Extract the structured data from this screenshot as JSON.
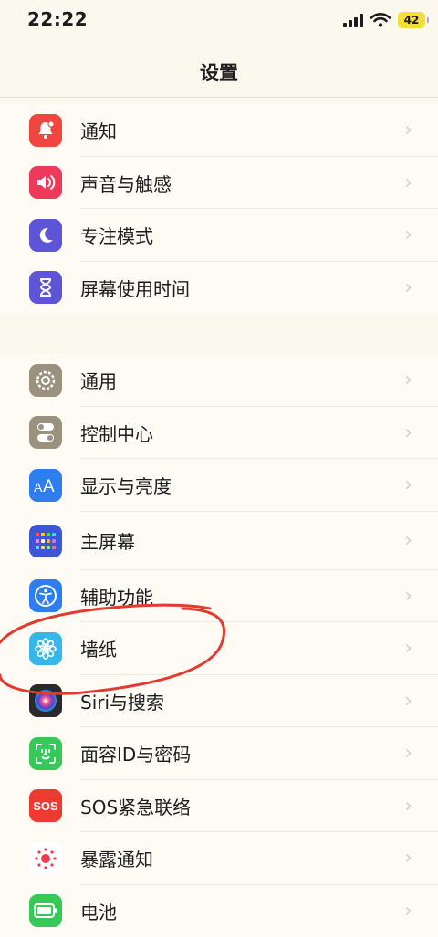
{
  "status_bar": {
    "time": "22:22",
    "battery_level": "42"
  },
  "nav": {
    "title": "设置"
  },
  "groups": [
    {
      "items": [
        {
          "label": "通知",
          "icon": "bell-icon",
          "color": "#f0463f"
        },
        {
          "label": "声音与触感",
          "icon": "speaker-icon",
          "color": "#ee3a5a"
        },
        {
          "label": "专注模式",
          "icon": "moon-icon",
          "color": "#5e55d6"
        },
        {
          "label": "屏幕使用时间",
          "icon": "hourglass-icon",
          "color": "#5e55d6"
        }
      ]
    },
    {
      "items": [
        {
          "label": "通用",
          "icon": "gear-icon",
          "color": "#9a917e"
        },
        {
          "label": "控制中心",
          "icon": "toggles-icon",
          "color": "#9a917e"
        },
        {
          "label": "显示与亮度",
          "icon": "text-size-icon",
          "color": "#2f7ef0"
        },
        {
          "label": "主屏幕",
          "icon": "app-grid-icon",
          "color": "#3b56d6"
        },
        {
          "label": "辅助功能",
          "icon": "accessibility-icon",
          "color": "#2f7ef0"
        },
        {
          "label": "墙纸",
          "icon": "flower-icon",
          "color": "#36b6ea"
        },
        {
          "label": "Siri与搜索",
          "icon": "siri-icon",
          "color": "#2a2a2e"
        },
        {
          "label": "面容ID与密码",
          "icon": "face-id-icon",
          "color": "#37c85a"
        },
        {
          "label": "SOS紧急联络",
          "icon": "sos-icon",
          "color": "#ee3a30"
        },
        {
          "label": "暴露通知",
          "icon": "exposure-icon",
          "color": "#ffffff"
        },
        {
          "label": "电池",
          "icon": "battery-icon",
          "color": "#37c85a"
        }
      ]
    }
  ],
  "sos_text": "SOS"
}
